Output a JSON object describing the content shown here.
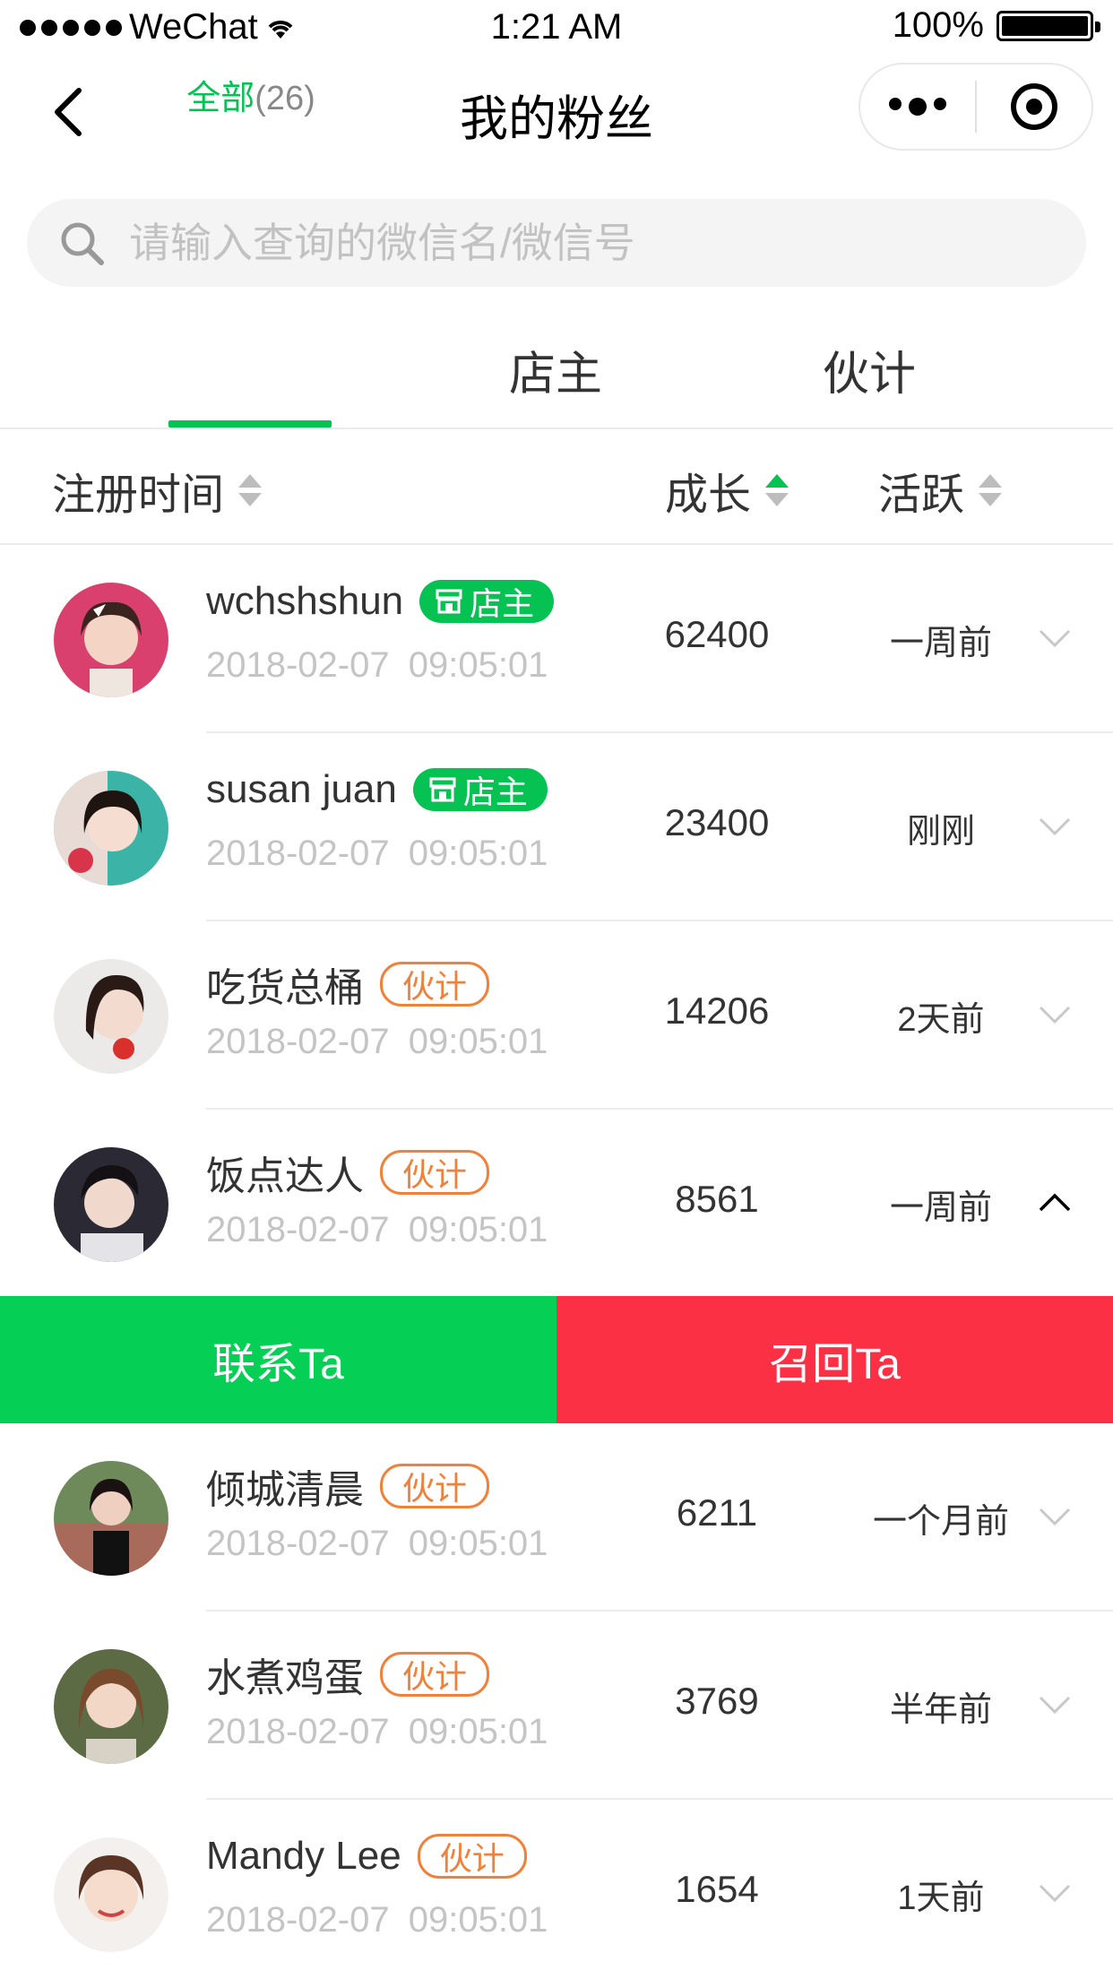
{
  "status_bar": {
    "carrier": "WeChat",
    "time": "1:21 AM",
    "battery": "100%"
  },
  "nav": {
    "title": "我的粉丝"
  },
  "search": {
    "placeholder": "请输入查询的微信名/微信号"
  },
  "tabs": [
    {
      "label": "全部",
      "count": "(26)",
      "active": true
    },
    {
      "label": "店主"
    },
    {
      "label": "伙计"
    }
  ],
  "sort_header": {
    "register_time": "注册时间",
    "growth": "成长",
    "active": "活跃"
  },
  "badges": {
    "owner": "店主",
    "staff": "伙计"
  },
  "fans": [
    {
      "name": "wchshshun",
      "role": "owner",
      "date": "2018-02-07  09:05:01",
      "growth": "62400",
      "active": "一周前",
      "expanded": false
    },
    {
      "name": "susan juan",
      "role": "owner",
      "date": "2018-02-07  09:05:01",
      "growth": "23400",
      "active": "刚刚",
      "expanded": false
    },
    {
      "name": "吃货总桶",
      "role": "staff",
      "date": "2018-02-07  09:05:01",
      "growth": "14206",
      "active": "2天前",
      "expanded": false
    },
    {
      "name": "饭点达人",
      "role": "staff",
      "date": "2018-02-07  09:05:01",
      "growth": "8561",
      "active": "一周前",
      "expanded": true
    },
    {
      "name": "倾城清晨",
      "role": "staff",
      "date": "2018-02-07  09:05:01",
      "growth": "6211",
      "active": "一个月前",
      "expanded": false
    },
    {
      "name": "水煮鸡蛋",
      "role": "staff",
      "date": "2018-02-07  09:05:01",
      "growth": "3769",
      "active": "半年前",
      "expanded": false
    },
    {
      "name": "Mandy Lee",
      "role": "staff",
      "date": "2018-02-07  09:05:01",
      "growth": "1654",
      "active": "1天前",
      "expanded": false
    }
  ],
  "actions": {
    "contact": "联系Ta",
    "recall": "召回Ta"
  },
  "colors": {
    "brand_green": "#05c252",
    "contact_green": "#05cf55",
    "recall_red": "#fb3044",
    "staff_orange": "#f0813a"
  }
}
